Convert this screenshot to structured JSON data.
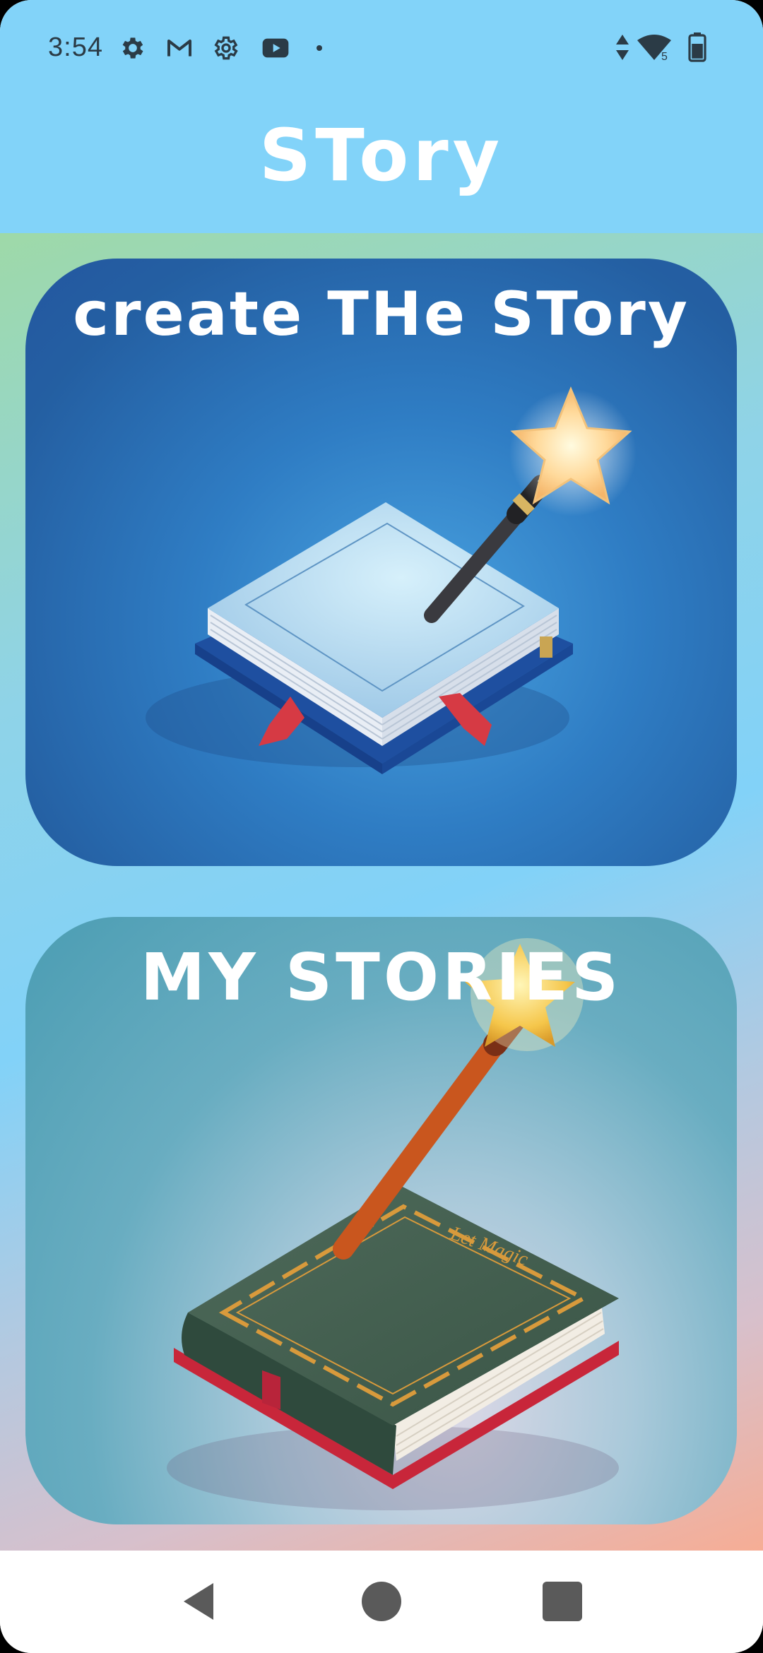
{
  "status_bar": {
    "time": "3:54",
    "left_icons": [
      "settings-icon",
      "gmail-icon",
      "settings-icon",
      "youtube-icon",
      "notification-dot-icon"
    ],
    "right_icons": [
      "data-arrows-icon",
      "wifi-icon",
      "battery-icon"
    ],
    "wifi_label": "5"
  },
  "app_bar": {
    "title": "STory",
    "background": "#82d3f9"
  },
  "cards": {
    "create": {
      "title": "create THe STory",
      "illustration": "magic-wand-book-illustration"
    },
    "mine": {
      "title": "MY STORIES",
      "illustration": "magic-wand-green-book-illustration",
      "book_cover_text": "Let Magic"
    }
  },
  "nav_bar": {
    "buttons": [
      "back-icon",
      "home-icon",
      "recents-icon"
    ]
  }
}
